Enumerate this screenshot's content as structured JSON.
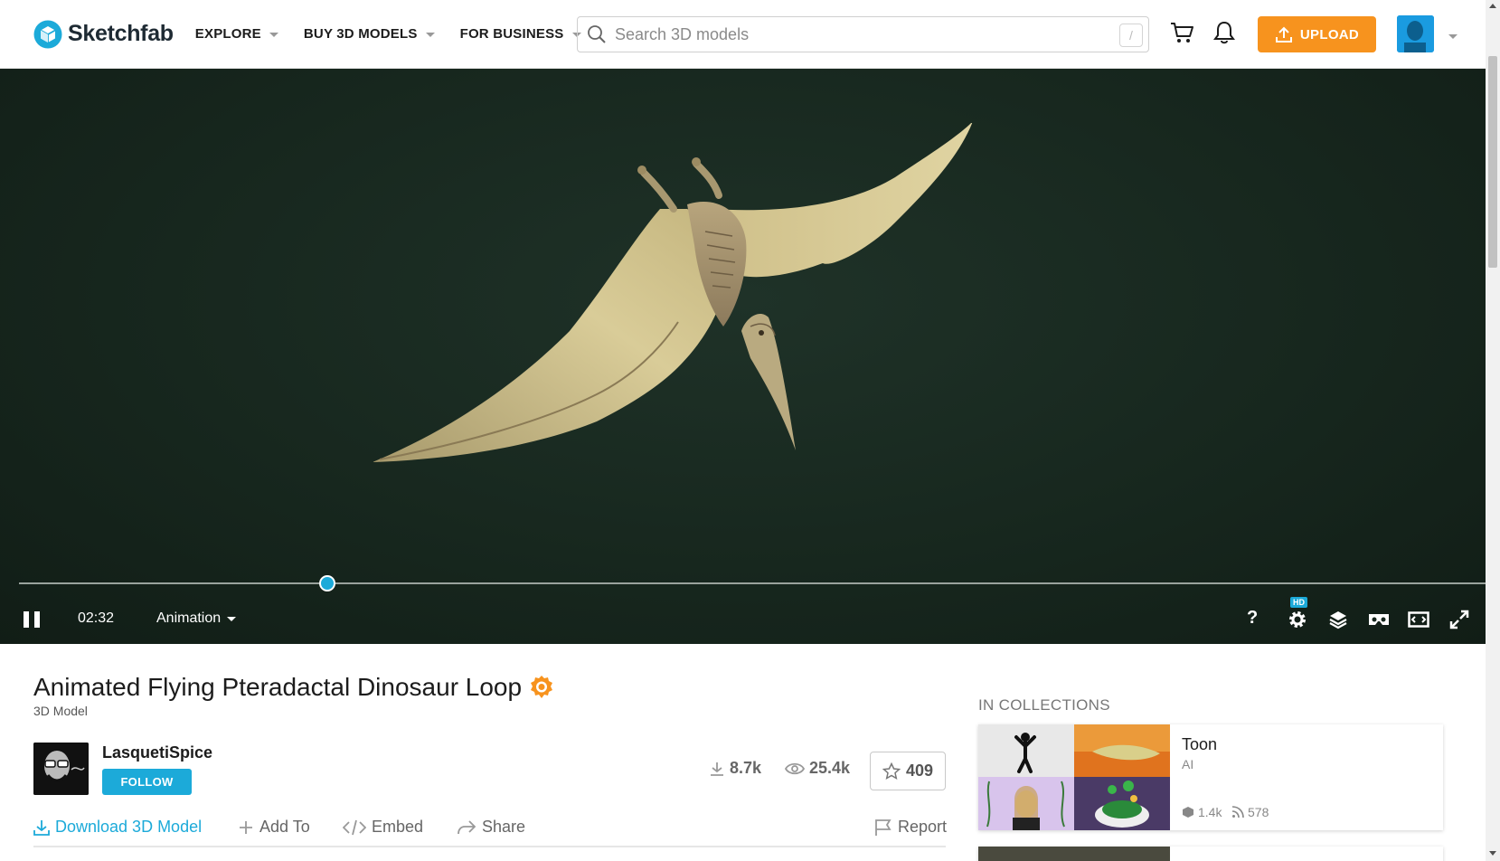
{
  "header": {
    "logo_text": "Sketchfab",
    "nav": [
      {
        "label": "EXPLORE"
      },
      {
        "label": "BUY 3D MODELS"
      },
      {
        "label": "FOR BUSINESS"
      }
    ],
    "search_placeholder": "Search 3D models",
    "search_shortcut": "/",
    "upload_label": "UPLOAD",
    "accent_color": "#f7931e"
  },
  "viewer": {
    "progress": 0.21,
    "time": "02:32",
    "animation_label": "Animation",
    "hd_badge": "HD",
    "help_label": "?",
    "knob_color": "#1caad9"
  },
  "model": {
    "title": "Animated Flying Pteradactal Dinosaur Loop",
    "type": "3D Model",
    "author": "LasquetiSpice",
    "follow_label": "FOLLOW",
    "downloads": "8.7k",
    "views": "25.4k",
    "likes": "409"
  },
  "actions": {
    "download": "Download 3D Model",
    "add_to": "Add To",
    "embed": "Embed",
    "share": "Share",
    "report": "Report"
  },
  "collections": {
    "heading": "IN COLLECTIONS",
    "items": [
      {
        "name": "Toon",
        "owner": "AI",
        "models": "1.4k",
        "followers": "578"
      }
    ]
  }
}
